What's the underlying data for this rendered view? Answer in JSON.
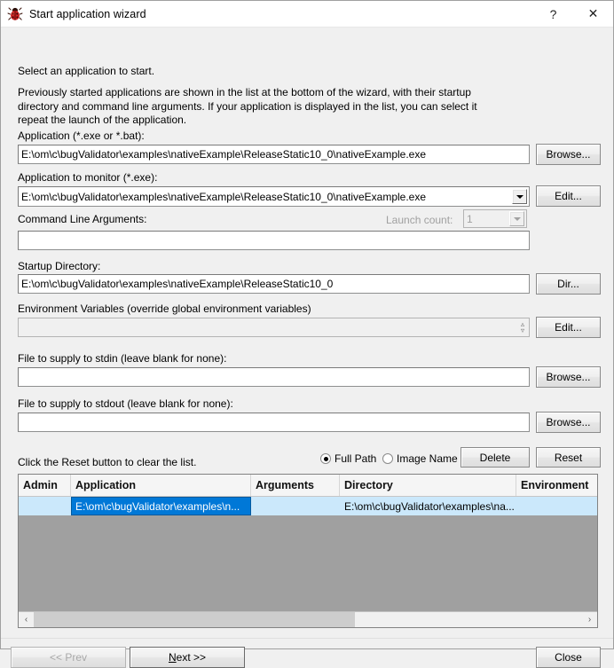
{
  "window": {
    "title": "Start application wizard",
    "icon": "bug-icon",
    "help_label": "?",
    "close_label": "✕"
  },
  "intro": {
    "heading": "Select an application to start.",
    "paragraph": "Previously started applications are shown in the list at the bottom of the wizard, with their startup directory and command line arguments. If your application is displayed in the list, you can select it repeat the launch of the application."
  },
  "fields": {
    "application": {
      "label": "Application (*.exe or *.bat):",
      "value": "E:\\om\\c\\bugValidator\\examples\\nativeExample\\ReleaseStatic10_0\\nativeExample.exe",
      "button": "Browse..."
    },
    "application_to_monitor": {
      "label": "Application to monitor (*.exe):",
      "value": "E:\\om\\c\\bugValidator\\examples\\nativeExample\\ReleaseStatic10_0\\nativeExample.exe",
      "button": "Edit..."
    },
    "command_line_arguments": {
      "label": "Command Line Arguments:",
      "value": ""
    },
    "launch_count": {
      "label": "Launch count:",
      "value": "1"
    },
    "startup_directory": {
      "label": "Startup Directory:",
      "value": "E:\\om\\c\\bugValidator\\examples\\nativeExample\\ReleaseStatic10_0",
      "button": "Dir..."
    },
    "environment_variables": {
      "label": "Environment Variables (override global environment variables)",
      "value": "",
      "button": "Edit..."
    },
    "stdin": {
      "label": "File to supply to stdin (leave blank for none):",
      "value": "",
      "button": "Browse..."
    },
    "stdout": {
      "label": "File to supply to stdout (leave blank for none):",
      "value": "",
      "button": "Browse..."
    }
  },
  "list_options": {
    "hint": "Click the Reset button to clear the list.",
    "radio_full_path": "Full Path",
    "radio_image_name": "Image Name",
    "selected_radio": "Full Path",
    "delete_button": "Delete",
    "reset_button": "Reset"
  },
  "list": {
    "columns": [
      "Admin",
      "Application",
      "Arguments",
      "Directory",
      "Environment"
    ],
    "rows": [
      {
        "admin": "",
        "application": "E:\\om\\c\\bugValidator\\examples\\n...",
        "arguments": "",
        "directory": "E:\\om\\c\\bugValidator\\examples\\na...",
        "environment": ""
      }
    ],
    "scroll_left_icon": "‹",
    "scroll_right_icon": "›"
  },
  "footer": {
    "prev_button": "<< Prev",
    "next_button_prefix": "",
    "next_button_accel": "N",
    "next_button_suffix": "ext >>",
    "close_button": "Close"
  },
  "colors": {
    "selection_blue": "#0078d7",
    "row_highlight": "#cbe8fb",
    "list_background": "#a0a0a0",
    "dialog_face": "#f0f0f0"
  }
}
